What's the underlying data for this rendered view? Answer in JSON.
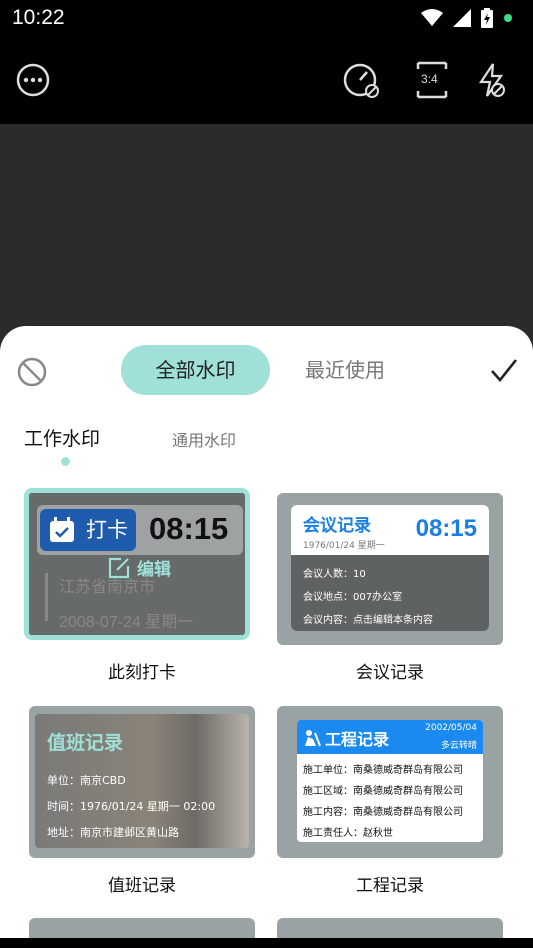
{
  "status": {
    "time": "10:22"
  },
  "icons": {
    "more": "more-circle-icon",
    "timer": "timer-off-icon",
    "ratio": "aspect-ratio-icon",
    "flash": "flash-off-icon",
    "ban": "no-watermark-icon",
    "check": "check-icon",
    "edit": "edit-icon",
    "calendar": "calendar-check-icon",
    "worker": "construction-worker-icon"
  },
  "toolbar": {
    "ratio_label": "3:4"
  },
  "sheet": {
    "seg_all": "全部水印",
    "seg_recent": "最近使用"
  },
  "subtabs": {
    "work": "工作水印",
    "general": "通用水印"
  },
  "cards": {
    "daka": {
      "label": "此刻打卡",
      "badge": "打卡",
      "time": "08:15",
      "location": "江苏省南京市",
      "date": "2008-07-24  星期一",
      "edit": "编辑"
    },
    "meeting": {
      "label": "会议记录",
      "title": "会议记录",
      "date": "1976/01/24   星期一",
      "time": "08:15",
      "rows": [
        "会议人数：10",
        "会议地点：007办公室",
        "会议内容：点击编辑本条内容"
      ]
    },
    "duty": {
      "label": "值班记录",
      "title": "值班记录",
      "rows": [
        "单位：南京CBD",
        "时间：1976/01/24  星期一  02:00",
        "地址：南京市建邺区黄山路"
      ]
    },
    "project": {
      "label": "工程记录",
      "title": "工程记录",
      "date": "2002/05/04",
      "weather": "多云转晴",
      "rows": [
        "施工单位：南桑德威奇群岛有限公司",
        "施工区域：南桑德威奇群岛有限公司",
        "施工内容：南桑德威奇群岛有限公司",
        "施工责任人：赵秋世"
      ]
    }
  },
  "colors": {
    "accent": "#9fe0d9",
    "blue": "#1a7fe0"
  }
}
